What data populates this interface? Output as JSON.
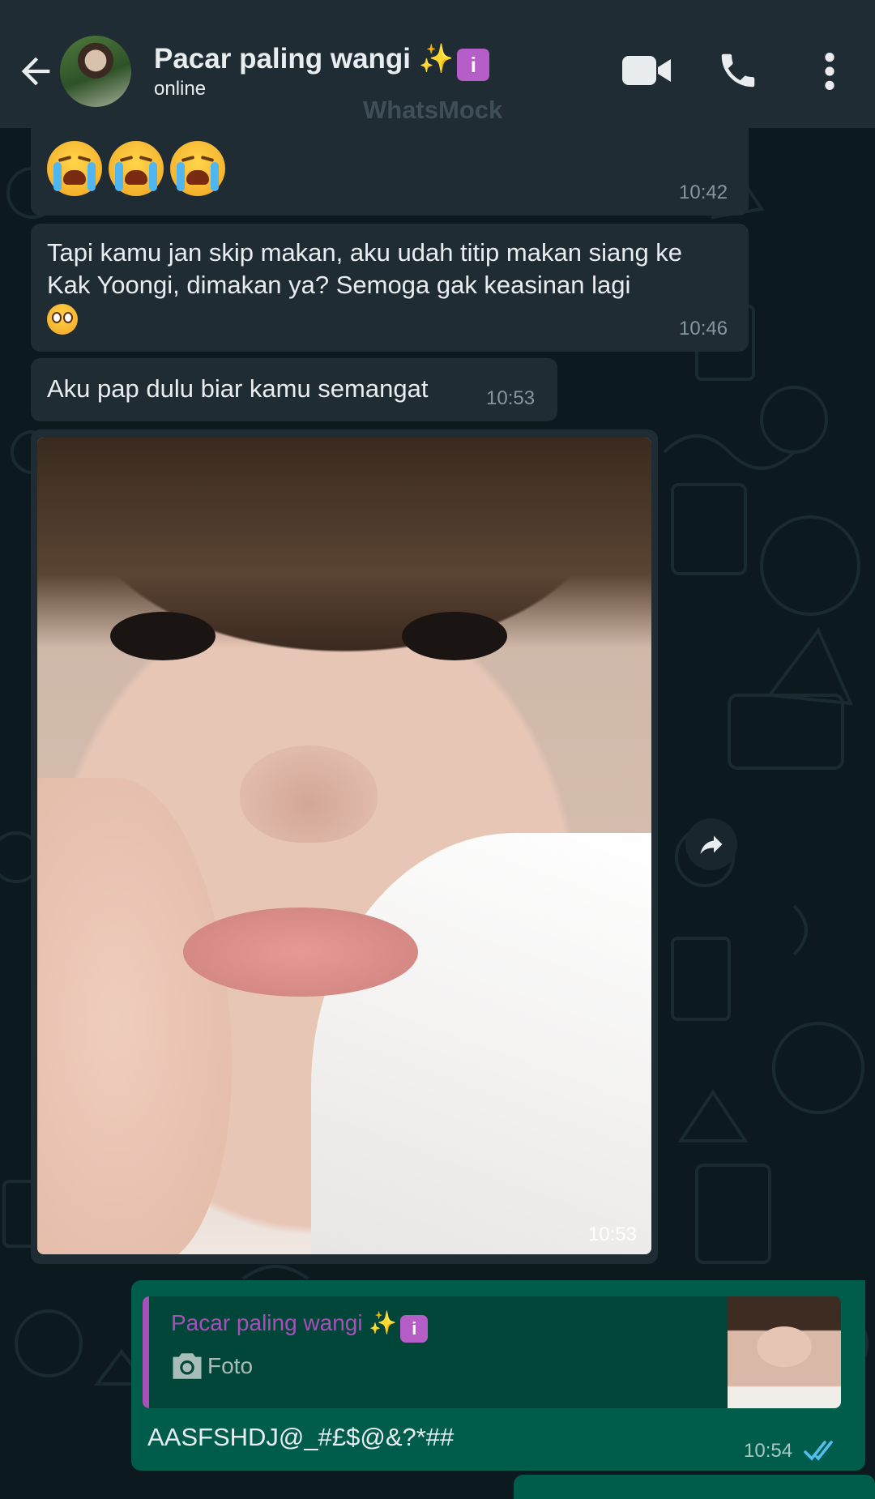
{
  "header": {
    "contact_name": "Pacar paling wangi",
    "name_emoji_sparkles": "✨",
    "name_badge": "i",
    "status": "online",
    "watermark": "WhatsMock",
    "icons": [
      "back-arrow-icon",
      "video-call-icon",
      "phone-icon",
      "more-vertical-icon"
    ]
  },
  "messages": [
    {
      "type": "emoji",
      "content": "😭😭😭",
      "time": "10:42"
    },
    {
      "type": "text",
      "text": "Tapi kamu jan skip makan, aku udah titip makan siang ke Kak Yoongi, dimakan ya? Semoga gak keasinan lagi",
      "trailing_emoji": "🥺",
      "time": "10:46"
    },
    {
      "type": "text",
      "text": "Aku pap dulu biar kamu semangat",
      "time": "10:53"
    },
    {
      "type": "photo",
      "time": "10:53"
    }
  ],
  "reply": {
    "quoted_name": "Pacar paling wangi",
    "quoted_type": "Foto",
    "text": "AASFSHDJ@_#£$@&?*##",
    "time": "10:54",
    "status": "read"
  },
  "colors": {
    "header_bg": "#1f2c34",
    "chat_bg": "#0c1a20",
    "incoming_bubble": "#1f2c34",
    "outgoing_bubble": "#005c4b",
    "quote_accent": "#a84fba",
    "read_tick": "#53bdeb"
  }
}
